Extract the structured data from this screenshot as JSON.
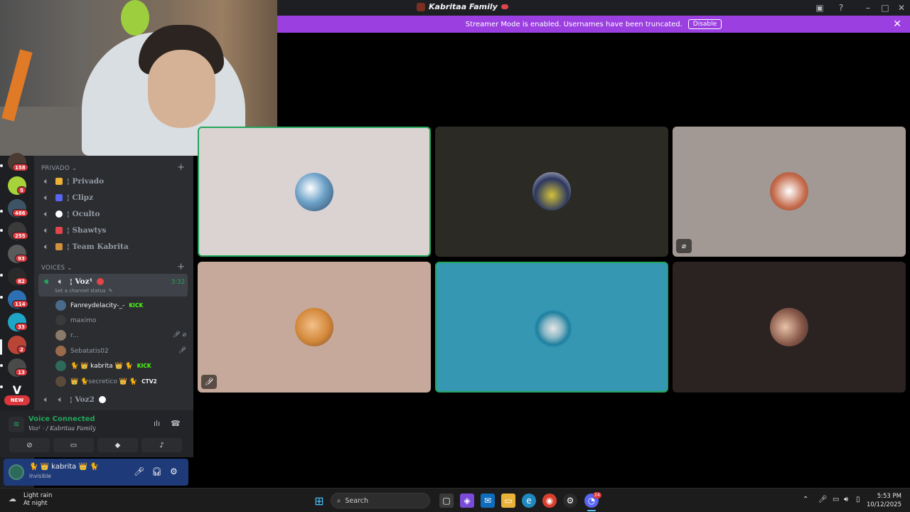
{
  "window": {
    "title": "Kabritaa Family",
    "icons": [
      "inbox-icon",
      "help-icon",
      "minimize-icon",
      "maximize-icon",
      "close-icon"
    ]
  },
  "banner": {
    "message": "Streamer Mode is enabled. Usernames have been truncated.",
    "button_label": "Disable",
    "close_symbol": "✕"
  },
  "rail": {
    "servers": [
      {
        "badge": "158",
        "color": "#4a3b33"
      },
      {
        "badge": "5",
        "color": "#a6d23a"
      },
      {
        "badge": "486",
        "color": "#3d5467"
      },
      {
        "badge": "255",
        "color": "#3a3a3a"
      },
      {
        "badge": "93",
        "color": "#5a5a5a"
      },
      {
        "badge": "82",
        "color": "#2a2a2a"
      },
      {
        "badge": "114",
        "color": "#2d6fb3"
      },
      {
        "badge": "33",
        "color": "#1fa6c6"
      },
      {
        "badge": "2",
        "color": "#b84536"
      },
      {
        "badge": "13",
        "color": "#4a4a4a"
      },
      {
        "badge": "",
        "color": "#1e1f22"
      }
    ],
    "new_label": "NEW"
  },
  "channels": {
    "category_private": "PRIVADO",
    "private_channels": [
      {
        "label": "¦ Privado",
        "emoji_color": "#f0b232"
      },
      {
        "label": "¦ Clipz",
        "emoji_color": "#5865f2"
      },
      {
        "label": "¦ Oculto",
        "emoji_color": "#ffffff"
      },
      {
        "label": "¦ Shawtys",
        "emoji_color": "#e0454b"
      },
      {
        "label": "¦ Team Kabrita",
        "emoji_color": "#d1913c"
      }
    ],
    "category_voices": "VOICES",
    "active_channel": {
      "label": "¦ Voz¹",
      "timer": "3:32",
      "status_placeholder": "Set a channel status"
    },
    "voice_users": [
      {
        "name": "Fanreydelacity-_-",
        "tag": "KICK",
        "tag_type": "kick",
        "avatar": "#4a6b8c"
      },
      {
        "name": "maximo",
        "tag": "",
        "tag_type": "",
        "avatar": "#3a3a3a"
      },
      {
        "name": "r...",
        "tag": "",
        "tag_type": "",
        "avatar": "#8a7a6a"
      },
      {
        "name": "Sebatatis02",
        "tag": "",
        "tag_type": "",
        "avatar": "#9a6a4a"
      },
      {
        "name": "🐈 👑 kabrita 👑 🐈",
        "tag": "KICK",
        "tag_type": "kick",
        "avatar": "#2e6a5a"
      },
      {
        "name": "👑 🐈secretico 👑 🐈",
        "tag": "CTV2",
        "tag_type": "ctv",
        "avatar": "#5a4a3a"
      }
    ],
    "other_channel": "¦ Voz2"
  },
  "voice_panel": {
    "status": "Voice Connected",
    "location": "Voz¹ · / Kabritaa Family"
  },
  "user_panel": {
    "name": "🐈 👑 kabrita 👑 🐈",
    "status": "Invisible"
  },
  "tiles": [
    {
      "bg": "#dbd2d2",
      "speaking": true,
      "muted": false,
      "avatar": "#6fa3c9"
    },
    {
      "bg": "#2b2a25",
      "speaking": false,
      "muted": false,
      "avatar": "#2c3760"
    },
    {
      "bg": "#a39994",
      "speaking": false,
      "muted": true,
      "avatar": "#c46a4a"
    },
    {
      "bg": "#c6a99a",
      "speaking": false,
      "muted": true,
      "avatar": "#d3883a"
    },
    {
      "bg": "#3697b3",
      "speaking": true,
      "muted": false,
      "avatar": "#1f7f9e"
    },
    {
      "bg": "#2b2222",
      "speaking": false,
      "muted": false,
      "avatar": "#8a5a4a"
    }
  ],
  "taskbar": {
    "weather_line1": "Light rain",
    "weather_line2": "At night",
    "search_label": "Search",
    "time": "5:53 PM",
    "date": "10/12/2025",
    "discord_badge": "24"
  }
}
